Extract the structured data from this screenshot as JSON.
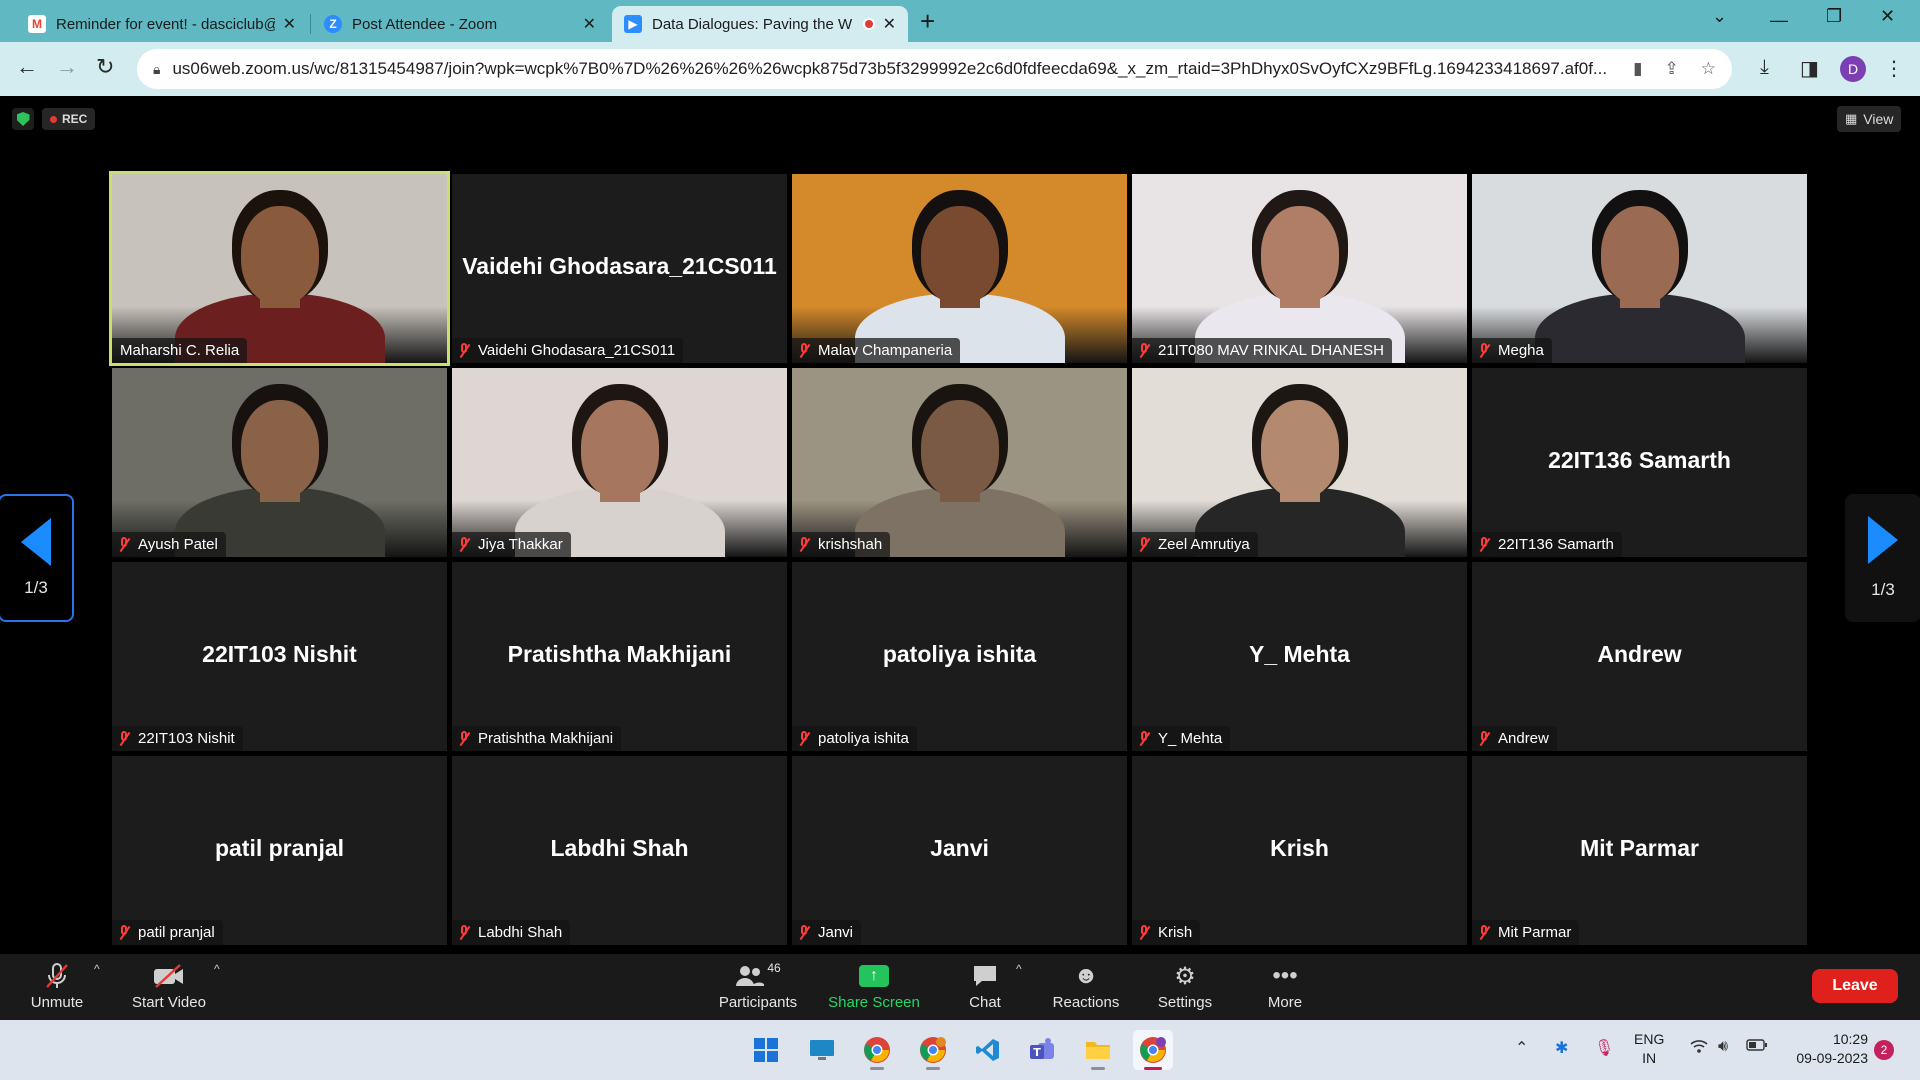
{
  "browser": {
    "tabs": [
      {
        "title": "Reminder for event! - dasciclub@",
        "icon": "gmail-icon",
        "color": "#ea4335"
      },
      {
        "title": "Post Attendee - Zoom",
        "icon": "zoom-icon",
        "color": "#2d8cff"
      },
      {
        "title": "Data Dialogues: Paving the W",
        "icon": "zoom-icon",
        "color": "#2d8cff",
        "active": true
      }
    ],
    "url": "us06web.zoom.us/wc/81315454987/join?wpk=wcpk%7B0%7D%26%26%26%26wcpk875d73b5f3299992e2c6d0fdfeecda69&_x_zm_rtaid=3PhDhyx0SvOyfCXz9BFfLg.1694233418697.af0f...",
    "profile_initial": "D"
  },
  "zoom": {
    "rec_label": "REC",
    "view_label": "View",
    "page_indicator": "1/3",
    "participants": [
      {
        "name": "Maharshi C. Relia",
        "video": true,
        "active_speaker": true,
        "muted": false,
        "bg": "#c8c2bc",
        "skin": "#8a5a3c",
        "hair": "#1c120c",
        "shirt": "#6b1f1f"
      },
      {
        "name": "Vaidehi Ghodasara_21CS011",
        "video": false,
        "muted": true
      },
      {
        "name": "Malav Champaneria",
        "video": true,
        "muted": true,
        "bg": "#d48a2a",
        "skin": "#7a4a30",
        "hair": "#141010",
        "shirt": "#dde3ea"
      },
      {
        "name": "21IT080 MAV RINKAL DHANESH",
        "video": true,
        "muted": true,
        "bg": "#e8e4e6",
        "skin": "#b07e66",
        "hair": "#1f1814",
        "shirt": "#eae7ee"
      },
      {
        "name": "Megha",
        "video": true,
        "muted": true,
        "bg": "#d9dcdf",
        "skin": "#9a6a52",
        "hair": "#121010",
        "shirt": "#2a2a30"
      },
      {
        "name": "Ayush Patel",
        "video": true,
        "muted": true,
        "bg": "#6e6e66",
        "skin": "#8a6248",
        "hair": "#171210",
        "shirt": "#3a3a34"
      },
      {
        "name": "Jiya Thakkar",
        "video": true,
        "muted": true,
        "bg": "#ddd6d2",
        "skin": "#a7765e",
        "hair": "#1e1612",
        "shirt": "#d8d2ce"
      },
      {
        "name": "krishshah",
        "video": true,
        "muted": true,
        "bg": "#9c9482",
        "skin": "#7a5a44",
        "hair": "#1a1410",
        "shirt": "#7e7264"
      },
      {
        "name": "Zeel Amrutiya",
        "video": true,
        "muted": true,
        "bg": "#e2ddd7",
        "skin": "#b38a70",
        "hair": "#1d1714",
        "shirt": "#262626"
      },
      {
        "name": "22IT136 Samarth",
        "video": false,
        "muted": true
      },
      {
        "name": "22IT103 Nishit",
        "video": false,
        "muted": true
      },
      {
        "name": "Pratishtha Makhijani",
        "video": false,
        "muted": true
      },
      {
        "name": "patoliya ishita",
        "video": false,
        "muted": true
      },
      {
        "name": "Y_ Mehta",
        "video": false,
        "muted": true
      },
      {
        "name": "Andrew",
        "video": false,
        "muted": true
      },
      {
        "name": "patil pranjal",
        "video": false,
        "muted": true
      },
      {
        "name": "Labdhi Shah",
        "video": false,
        "muted": true
      },
      {
        "name": "Janvi",
        "video": false,
        "muted": true
      },
      {
        "name": "Krish",
        "video": false,
        "muted": true
      },
      {
        "name": "Mit Parmar",
        "video": false,
        "muted": true
      }
    ],
    "controls": {
      "unmute": "Unmute",
      "start_video": "Start Video",
      "participants": "Participants",
      "participants_count": "46",
      "share_screen": "Share Screen",
      "chat": "Chat",
      "reactions": "Reactions",
      "settings": "Settings",
      "more": "More",
      "leave": "Leave"
    }
  },
  "taskbar": {
    "lang_top": "ENG",
    "lang_bottom": "IN",
    "time": "10:29",
    "date": "09-09-2023",
    "notifications": "2"
  },
  "colors": {
    "tab_strip": "#5fb8c2",
    "toolbar": "#d2ecf0",
    "active_speaker_border": "#c9e06d",
    "leave": "#e0201c",
    "share_green": "#24c35c"
  }
}
